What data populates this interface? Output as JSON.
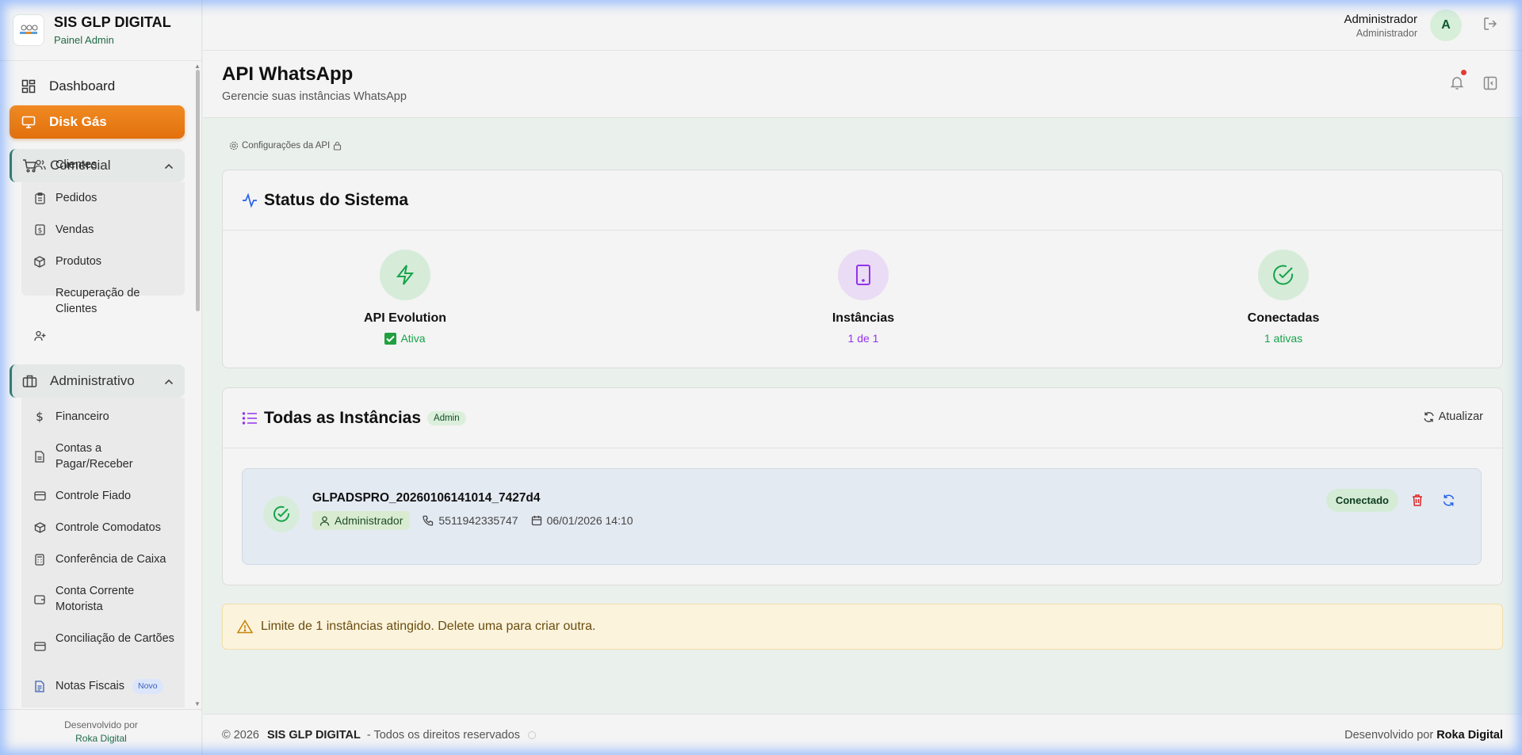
{
  "brand": {
    "title": "SIS GLP DIGITAL",
    "subtitle": "Painel Admin"
  },
  "nav": {
    "dashboard": "Dashboard",
    "disk_gas": "Disk Gás",
    "comercial": {
      "label": "Comercial",
      "items": [
        "Clientes",
        "Pedidos",
        "Vendas",
        "Produtos",
        "Recuperação de Clientes"
      ]
    },
    "administrativo": {
      "label": "Administrativo",
      "items": [
        "Financeiro",
        "Contas a Pagar/Receber",
        "Controle Fiado",
        "Controle Comodatos",
        "Conferência de Caixa",
        "Conta Corrente Motorista",
        "Conciliação de Cartões",
        "Notas Fiscais"
      ],
      "novo_badge": "Novo"
    }
  },
  "sidebar_footer": {
    "line1": "Desenvolvido por",
    "line2": "Roka Digital"
  },
  "user": {
    "name": "Administrador",
    "role": "Administrador",
    "initial": "A"
  },
  "page": {
    "title": "API WhatsApp",
    "subtitle": "Gerencie suas instâncias WhatsApp"
  },
  "api_config": "Configurações da API",
  "status_card": {
    "title": "Status do Sistema",
    "stats": [
      {
        "name": "API Evolution",
        "value": "Ativa",
        "color": "#16a34a"
      },
      {
        "name": "Instâncias",
        "value": "1 de 1",
        "color": "#9333ea"
      },
      {
        "name": "Conectadas",
        "value": "1 ativas",
        "color": "#16a34a"
      }
    ]
  },
  "instances_card": {
    "title": "Todas as Instâncias",
    "badge": "Admin",
    "refresh": "Atualizar",
    "instance": {
      "name": "GLPADSPRO_20260106141014_7427d4",
      "owner": "Administrador",
      "phone": "5511942335747",
      "date": "06/01/2026 14:10",
      "status": "Conectado"
    }
  },
  "alert": "Limite de 1 instâncias atingido. Delete uma para criar outra.",
  "footer": {
    "copyright": "© 2026",
    "brand": "SIS GLP DIGITAL",
    "rights": "- Todos os direitos reservados",
    "dev_prefix": "Desenvolvido por",
    "dev_name": "Roka Digital"
  },
  "colors": {
    "accent": "#e2700c",
    "brand_green": "#1f6b47",
    "danger": "#dc2626",
    "sync": "#2563eb"
  }
}
